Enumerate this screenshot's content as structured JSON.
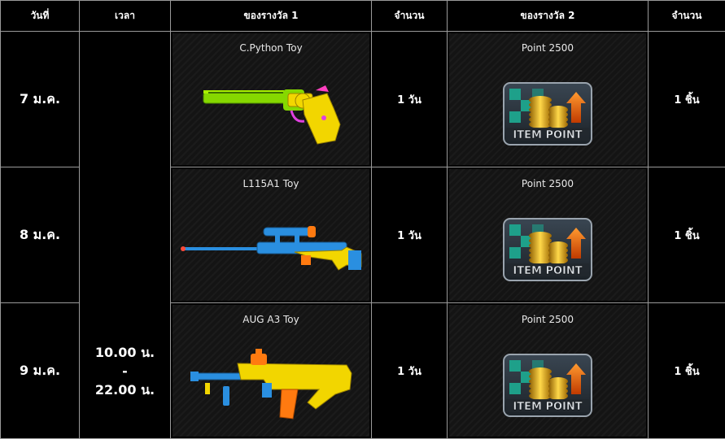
{
  "headers": {
    "date": "วันที่",
    "time": "เวลา",
    "reward1": "ของรางวัล 1",
    "qty1": "จำนวน",
    "reward2": "ของรางวัล 2",
    "qty2": "จำนวน"
  },
  "time_slot": {
    "start": "10.00 น.",
    "separator": "-",
    "end": "22.00 น."
  },
  "rows": [
    {
      "date": "7 ม.ค.",
      "reward1": "C.Python Toy",
      "reward1_icon": "revolver-toy-icon",
      "qty1": "1 วัน",
      "reward2": "Point 2500",
      "reward2_badge": "ITEM POINT",
      "qty2": "1 ชิ้น"
    },
    {
      "date": "8 ม.ค.",
      "reward1": "L115A1 Toy",
      "reward1_icon": "sniper-rifle-toy-icon",
      "qty1": "1 วัน",
      "reward2": "Point 2500",
      "reward2_badge": "ITEM POINT",
      "qty2": "1 ชิ้น"
    },
    {
      "date": "9 ม.ค.",
      "reward1": "AUG A3 Toy",
      "reward1_icon": "assault-rifle-toy-icon",
      "qty1": "1 วัน",
      "reward2": "Point 2500",
      "reward2_badge": "ITEM POINT",
      "qty2": "1 ชิ้น"
    }
  ],
  "colors": {
    "background": "#000000",
    "border": "#9a9a9a",
    "toy_green": "#7fd400",
    "toy_yellow": "#f2d600",
    "toy_blue": "#2a8fe0",
    "toy_orange": "#ff7a10"
  }
}
